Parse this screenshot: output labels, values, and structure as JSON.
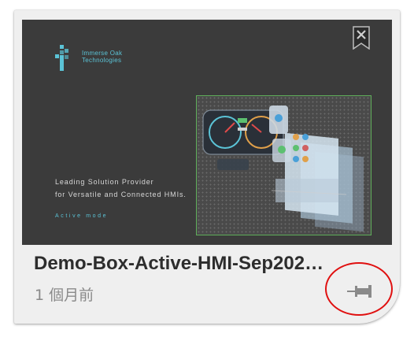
{
  "card": {
    "title": "Demo-Box-Active-HMI-Sep202…",
    "timestamp": "1 個月前"
  },
  "thumbnail": {
    "brand_line1": "Immerse Oak",
    "brand_line2": "Technologies",
    "headline_line1": "Leading Solution Provider",
    "headline_line2": "for Versatile and Connected HMIs.",
    "mode_label": "Active mode",
    "accent_color": "#5bc3d6",
    "frame_color": "#5fae5a"
  },
  "icons": {
    "bookmark": "bookmark-close-icon",
    "pin": "pin-icon",
    "logo": "company-logo-icon"
  },
  "annotation": {
    "highlight_color": "#e01010"
  }
}
